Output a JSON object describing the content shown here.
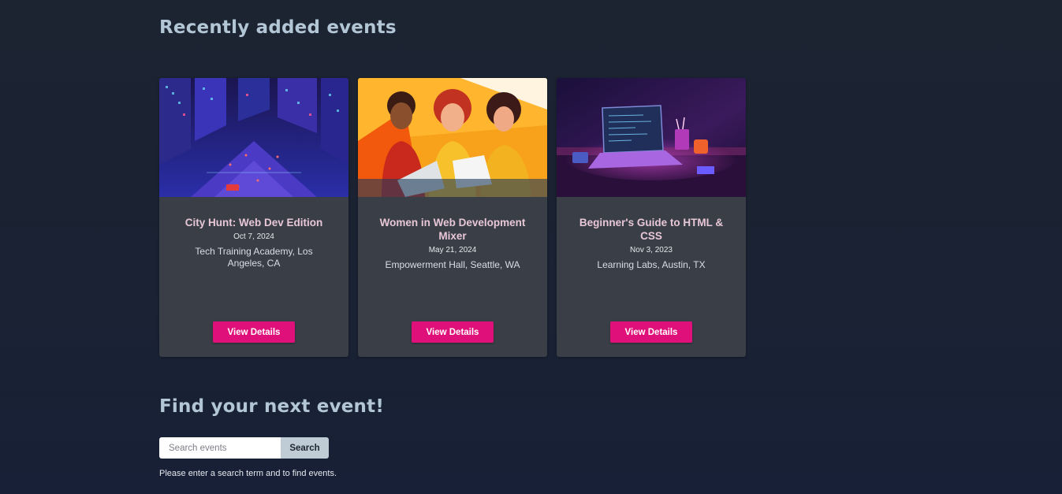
{
  "sections": {
    "recent_title": "Recently added events",
    "find_title": "Find your next event!"
  },
  "events": [
    {
      "title": "City Hunt: Web Dev Edition",
      "date": "Oct 7, 2024",
      "location": "Tech Training Academy, Los Angeles, CA",
      "button": "View Details",
      "image": "isometric-neon-city-illustration"
    },
    {
      "title": "Women in Web Development Mixer",
      "date": "May 21, 2024",
      "location": "Empowerment Hall, Seattle, WA",
      "button": "View Details",
      "image": "three-women-at-laptops-illustration"
    },
    {
      "title": "Beginner's Guide to HTML & CSS",
      "date": "Nov 3, 2023",
      "location": "Learning Labs, Austin, TX",
      "button": "View Details",
      "image": "laptop-on-desk-neon-illustration"
    }
  ],
  "search": {
    "placeholder": "Search events",
    "value": "",
    "button": "Search",
    "help": "Please enter a search term and to find events."
  },
  "colors": {
    "background": "#1c2331",
    "card": "#3a3f47",
    "accent": "#e0107a",
    "heading": "#b3c6d6",
    "card_title": "#e8c7d6"
  }
}
